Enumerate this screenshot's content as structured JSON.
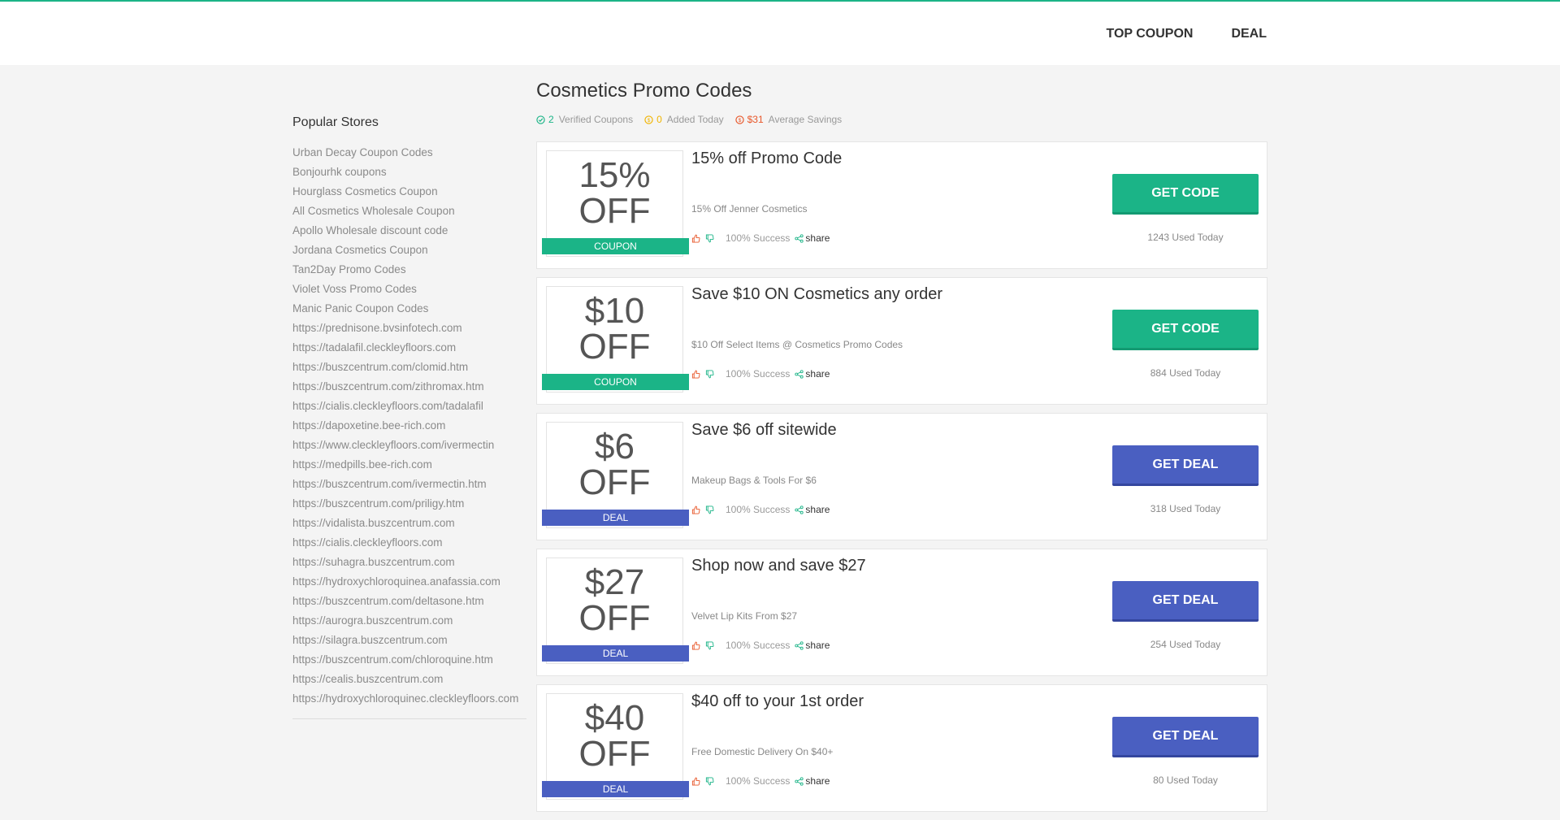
{
  "nav": {
    "items": [
      "TOP COUPON",
      "DEAL"
    ]
  },
  "sidebar": {
    "title": "Popular Stores",
    "stores": [
      "Urban Decay Coupon Codes",
      "Bonjourhk coupons",
      "Hourglass Cosmetics Coupon",
      "All Cosmetics Wholesale Coupon",
      "Apollo Wholesale discount code",
      "Jordana Cosmetics Coupon",
      "Tan2Day Promo Codes",
      "Violet Voss Promo Codes",
      "Manic Panic Coupon Codes",
      "https://prednisone.bvsinfotech.com",
      "https://tadalafil.cleckleyfloors.com",
      "https://buszcentrum.com/clomid.htm",
      "https://buszcentrum.com/zithromax.htm",
      "https://cialis.cleckleyfloors.com/tadalafil",
      "https://dapoxetine.bee-rich.com",
      "https://www.cleckleyfloors.com/ivermectin",
      "https://medpills.bee-rich.com",
      "https://buszcentrum.com/ivermectin.htm",
      "https://buszcentrum.com/priligy.htm",
      "https://vidalista.buszcentrum.com",
      "https://cialis.cleckleyfloors.com",
      "https://suhagra.buszcentrum.com",
      "https://hydroxychloroquinea.anafassia.com",
      "https://buszcentrum.com/deltasone.htm",
      "https://aurogra.buszcentrum.com",
      "https://silagra.buszcentrum.com",
      "https://buszcentrum.com/chloroquine.htm",
      "https://cealis.buszcentrum.com",
      "https://hydroxychloroquinec.cleckleyfloors.com"
    ]
  },
  "page": {
    "title": "Cosmetics Promo Codes",
    "stats": {
      "verified_count": "2",
      "verified_label": "Verified Coupons",
      "added_count": "0",
      "added_label": "Added Today",
      "savings_value": "$31",
      "savings_label": "Average Savings"
    }
  },
  "coupons": [
    {
      "amount": "15%",
      "off": "OFF",
      "type": "COUPON",
      "title": "15% off Promo Code",
      "desc": "15% Off Jenner Cosmetics",
      "success": "100% Success",
      "share": "share",
      "button": "GET CODE",
      "used": "1243 Used Today"
    },
    {
      "amount": "$10",
      "off": "OFF",
      "type": "COUPON",
      "title": "Save $10 ON Cosmetics any order",
      "desc": "$10 Off Select Items @ Cosmetics Promo Codes",
      "success": "100% Success",
      "share": "share",
      "button": "GET CODE",
      "used": "884 Used Today"
    },
    {
      "amount": "$6",
      "off": "OFF",
      "type": "DEAL",
      "title": "Save $6 off sitewide",
      "desc": "Makeup Bags & Tools For $6",
      "success": "100% Success",
      "share": "share",
      "button": "GET DEAL",
      "used": "318 Used Today"
    },
    {
      "amount": "$27",
      "off": "OFF",
      "type": "DEAL",
      "title": "Shop now and save $27",
      "desc": "Velvet Lip Kits From $27",
      "success": "100% Success",
      "share": "share",
      "button": "GET DEAL",
      "used": "254 Used Today"
    },
    {
      "amount": "$40",
      "off": "OFF",
      "type": "DEAL",
      "title": "$40 off to your 1st order",
      "desc": "Free Domestic Delivery On $40+",
      "success": "100% Success",
      "share": "share",
      "button": "GET DEAL",
      "used": "80 Used Today"
    }
  ],
  "colors": {
    "accent_green": "#1bb487",
    "accent_blue": "#4a5fc1",
    "savings_red": "#e8572a",
    "added_yellow": "#f0b400"
  }
}
